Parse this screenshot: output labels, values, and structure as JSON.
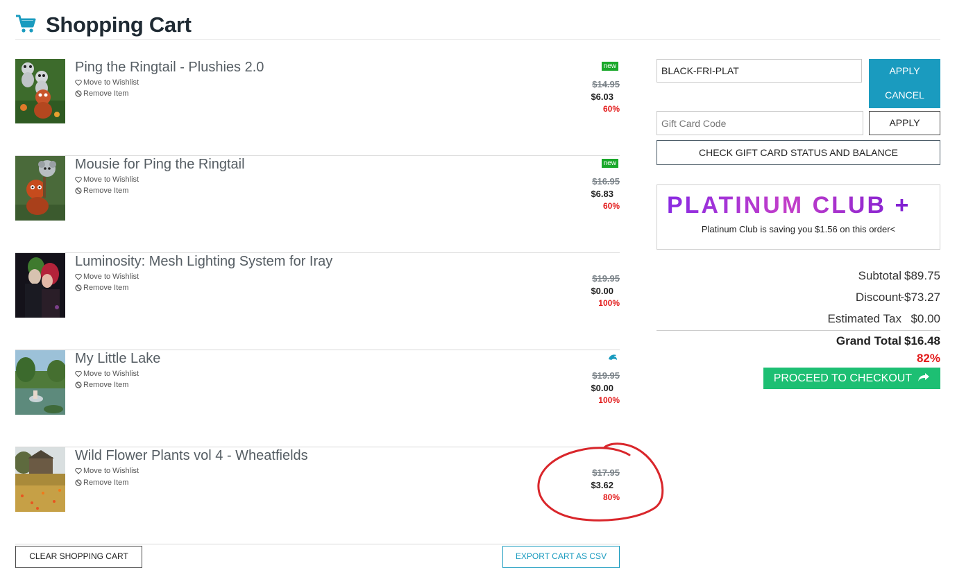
{
  "header": {
    "title": "Shopping Cart",
    "cart_icon": "cart-icon"
  },
  "items": [
    {
      "name": "Ping the Ringtail - Plushies 2.0",
      "badge": "new",
      "old_price": "$14.95",
      "price": "$6.03",
      "discount": "60%",
      "wishlist": "Move to Wishlist",
      "remove": "Remove Item"
    },
    {
      "name": "Mousie for Ping the Ringtail",
      "badge": "new",
      "old_price": "$16.95",
      "price": "$6.83",
      "discount": "60%",
      "wishlist": "Move to Wishlist",
      "remove": "Remove Item"
    },
    {
      "name": "Luminosity: Mesh Lighting System for Iray",
      "badge": "",
      "old_price": "$19.95",
      "price": "$0.00",
      "discount": "100%",
      "wishlist": "Move to Wishlist",
      "remove": "Remove Item"
    },
    {
      "name": "My Little Lake",
      "badge": "dolphin-icon",
      "old_price": "$19.95",
      "price": "$0.00",
      "discount": "100%",
      "wishlist": "Move to Wishlist",
      "remove": "Remove Item"
    },
    {
      "name": "Wild Flower Plants vol 4 - Wheatfields",
      "badge": "",
      "old_price": "$17.95",
      "price": "$3.62",
      "discount": "80%",
      "wishlist": "Move to Wishlist",
      "remove": "Remove Item"
    }
  ],
  "sidebar": {
    "coupon_value": "BLACK-FRI-PLAT",
    "apply_label": "APPLY",
    "cancel_label": "CANCEL",
    "gift_placeholder": "Gift Card Code",
    "gift_apply_label": "APPLY",
    "check_gift_label": "CHECK GIFT CARD STATUS AND BALANCE",
    "platinum_logo": "PLATINUM CLUB +",
    "platinum_message": "Platinum Club is saving you $1.56 on this order<",
    "subtotal_label": "Subtotal",
    "subtotal_value": "$89.75",
    "discount_label": "Discount",
    "discount_value": "-$73.27",
    "tax_label": "Estimated Tax",
    "tax_value": "$0.00",
    "grand_label": "Grand Total",
    "grand_value": "$16.48",
    "grand_pct": "82%",
    "checkout_label": "PROCEED TO CHECKOUT"
  },
  "footer": {
    "clear_label": "CLEAR SHOPPING CART",
    "export_label": "EXPORT CART AS CSV"
  },
  "colors": {
    "accent": "#1a9bbf",
    "checkout": "#1dbf73",
    "discount_red": "#e31b1b",
    "new_badge": "#19a82a"
  }
}
